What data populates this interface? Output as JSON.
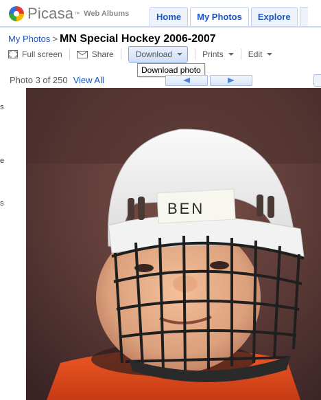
{
  "app": {
    "logo_word": "Picasa",
    "logo_tm": "™",
    "logo_sub": "Web Albums"
  },
  "tabs": [
    {
      "label": "Home"
    },
    {
      "label": "My Photos"
    },
    {
      "label": "Explore"
    }
  ],
  "breadcrumb": {
    "parent": "My Photos",
    "separator": ">",
    "title": "MN Special Hockey 2006-2007"
  },
  "toolbar": {
    "full_screen": "Full screen",
    "share": "Share",
    "download": "Download",
    "prints": "Prints",
    "edit": "Edit"
  },
  "tooltip": "Download photo",
  "photo_nav": {
    "count_text": "Photo 3 of 250",
    "view_all": "View All"
  },
  "gutter_letters": [
    "s",
    "e",
    "s"
  ],
  "photo": {
    "helmet_name": "BEN"
  },
  "colors": {
    "link": "#1a55c0",
    "tab_bg": "#eef3fb",
    "tab_border": "#c3d2ea",
    "jersey": "#e0481c"
  }
}
